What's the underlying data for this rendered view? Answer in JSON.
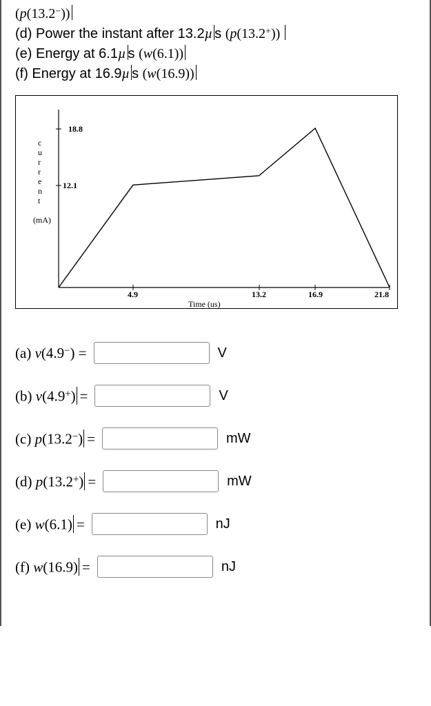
{
  "prompt": {
    "l0": "(p(13.2⁻))",
    "l1_text": "(d) Power the instant after 13.2",
    "l1_sym": "µ",
    "l1_unit": "s",
    "l1_mathA": "(p(13.2",
    "l1_sup": "+",
    "l1_mathB": "))",
    "l2_text": "(e) Energy at 6.1",
    "l2_sym": "µ",
    "l2_unit": "s",
    "l2_math": "(w(6.1))",
    "l3_text": "(f) Energy at 16.9",
    "l3_sym": "µ",
    "l3_unit": "s",
    "l3_math": "(w(16.9))"
  },
  "chart_data": {
    "type": "line",
    "x": [
      0,
      4.9,
      13.2,
      16.9,
      21.8
    ],
    "y": [
      0,
      12.1,
      13.2,
      18.8,
      0
    ],
    "title": "",
    "xlabel": "Time (us)",
    "ylabel_vertical": "current",
    "y_unit_label": "(mA)",
    "xticks": [
      4.9,
      13.2,
      16.9,
      21.8
    ],
    "yticks": [
      12.1,
      18.8
    ],
    "xlim": [
      0,
      21.8
    ],
    "ylim": [
      0,
      21.0
    ]
  },
  "answers": [
    {
      "letter": "(a)",
      "fn": "v",
      "arg": "4.9",
      "sup": "−",
      "unit": "V",
      "vline": false
    },
    {
      "letter": "(b)",
      "fn": "v",
      "arg": "4.9",
      "sup": "+",
      "unit": "V",
      "vline": true
    },
    {
      "letter": "(c)",
      "fn": "p",
      "arg": "13.2",
      "sup": "−",
      "unit": "mW",
      "vline": true
    },
    {
      "letter": "(d)",
      "fn": "p",
      "arg": "13.2",
      "sup": "+",
      "unit": "mW",
      "vline": true
    },
    {
      "letter": "(e)",
      "fn": "w",
      "arg": "6.1",
      "sup": "",
      "unit": "nJ",
      "vline": true
    },
    {
      "letter": "(f)",
      "fn": "w",
      "arg": "16.9",
      "sup": "",
      "unit": "nJ",
      "vline": true
    }
  ]
}
